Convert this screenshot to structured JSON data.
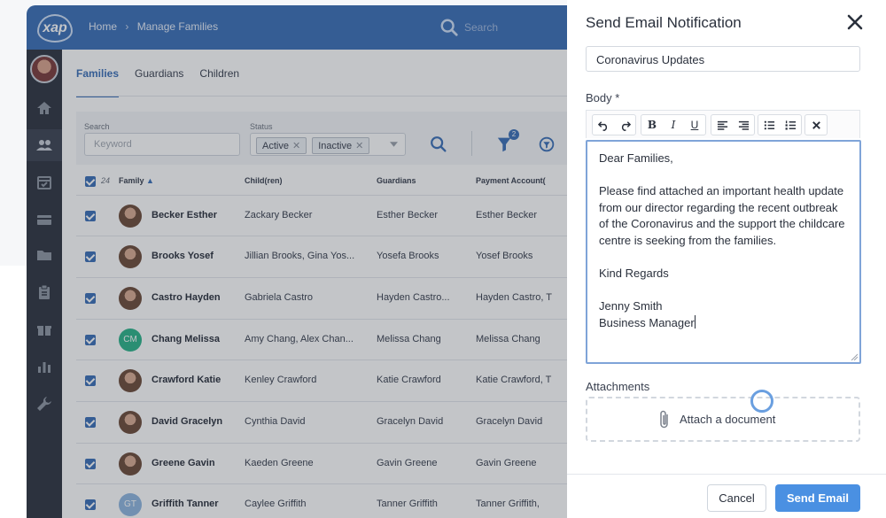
{
  "app": {
    "logo_text": "xap",
    "breadcrumb": [
      "Home",
      "Manage Families"
    ],
    "breadcrumb_sep": "›",
    "search_placeholder": "Search"
  },
  "tabs": [
    {
      "label": "Families",
      "active": true
    },
    {
      "label": "Guardians",
      "active": false
    },
    {
      "label": "Children",
      "active": false
    }
  ],
  "filters": {
    "search_label": "Search",
    "search_placeholder": "Keyword",
    "status_label": "Status",
    "status_chips": [
      "Active",
      "Inactive"
    ],
    "filter_badge": "2"
  },
  "table": {
    "count": "24",
    "columns": [
      "Family",
      "Child(ren)",
      "Guardians",
      "Payment Account("
    ],
    "rows": [
      {
        "family": "Becker Esther",
        "children": "Zackary Becker",
        "guardians": "Esther Becker",
        "payment": "Esther Becker",
        "initials": ""
      },
      {
        "family": "Brooks Yosef",
        "children": "Jillian Brooks, Gina Yos...",
        "guardians": "Yosefa Brooks",
        "payment": "Yosef Brooks",
        "initials": ""
      },
      {
        "family": "Castro Hayden",
        "children": "Gabriela Castro",
        "guardians": "Hayden Castro...",
        "payment": "Hayden Castro, T",
        "initials": ""
      },
      {
        "family": "Chang Melissa",
        "children": "Amy Chang, Alex Chan...",
        "guardians": "Melissa Chang",
        "payment": "Melissa Chang",
        "initials": "CM"
      },
      {
        "family": "Crawford Katie",
        "children": "Kenley Crawford",
        "guardians": "Katie Crawford",
        "payment": "Katie Crawford, T",
        "initials": ""
      },
      {
        "family": "David Gracelyn",
        "children": "Cynthia David",
        "guardians": "Gracelyn David",
        "payment": "Gracelyn David",
        "initials": ""
      },
      {
        "family": "Greene Gavin",
        "children": "Kaeden Greene",
        "guardians": "Gavin Greene",
        "payment": "Gavin Greene",
        "initials": ""
      },
      {
        "family": "Griffith Tanner",
        "children": "Caylee Griffith",
        "guardians": "Tanner Griffith",
        "payment": "Tanner Griffith,",
        "initials": "GT"
      }
    ]
  },
  "modal": {
    "title": "Send Email Notification",
    "subject_value": "Coronavirus Updates",
    "body_label": "Body *",
    "toolbar": {
      "bold": "B",
      "italic": "I",
      "underline": "U"
    },
    "body_lines": [
      "Dear Families,",
      "",
      "Please find attached an important health update from our director regarding the recent outbreak of the Coronavirus and the support the childcare centre is seeking from the families.",
      "",
      "Kind Regards",
      "",
      "Jenny Smith",
      "Business Manager"
    ],
    "attachments_label": "Attachments",
    "attach_text": "Attach a document",
    "cancel_label": "Cancel",
    "send_label": "Send Email"
  },
  "colors": {
    "brand": "#3b6fb7",
    "send_button": "#4a90e2",
    "avatar_cm": "#2bb38a",
    "avatar_gt": "#8fb6e0"
  }
}
